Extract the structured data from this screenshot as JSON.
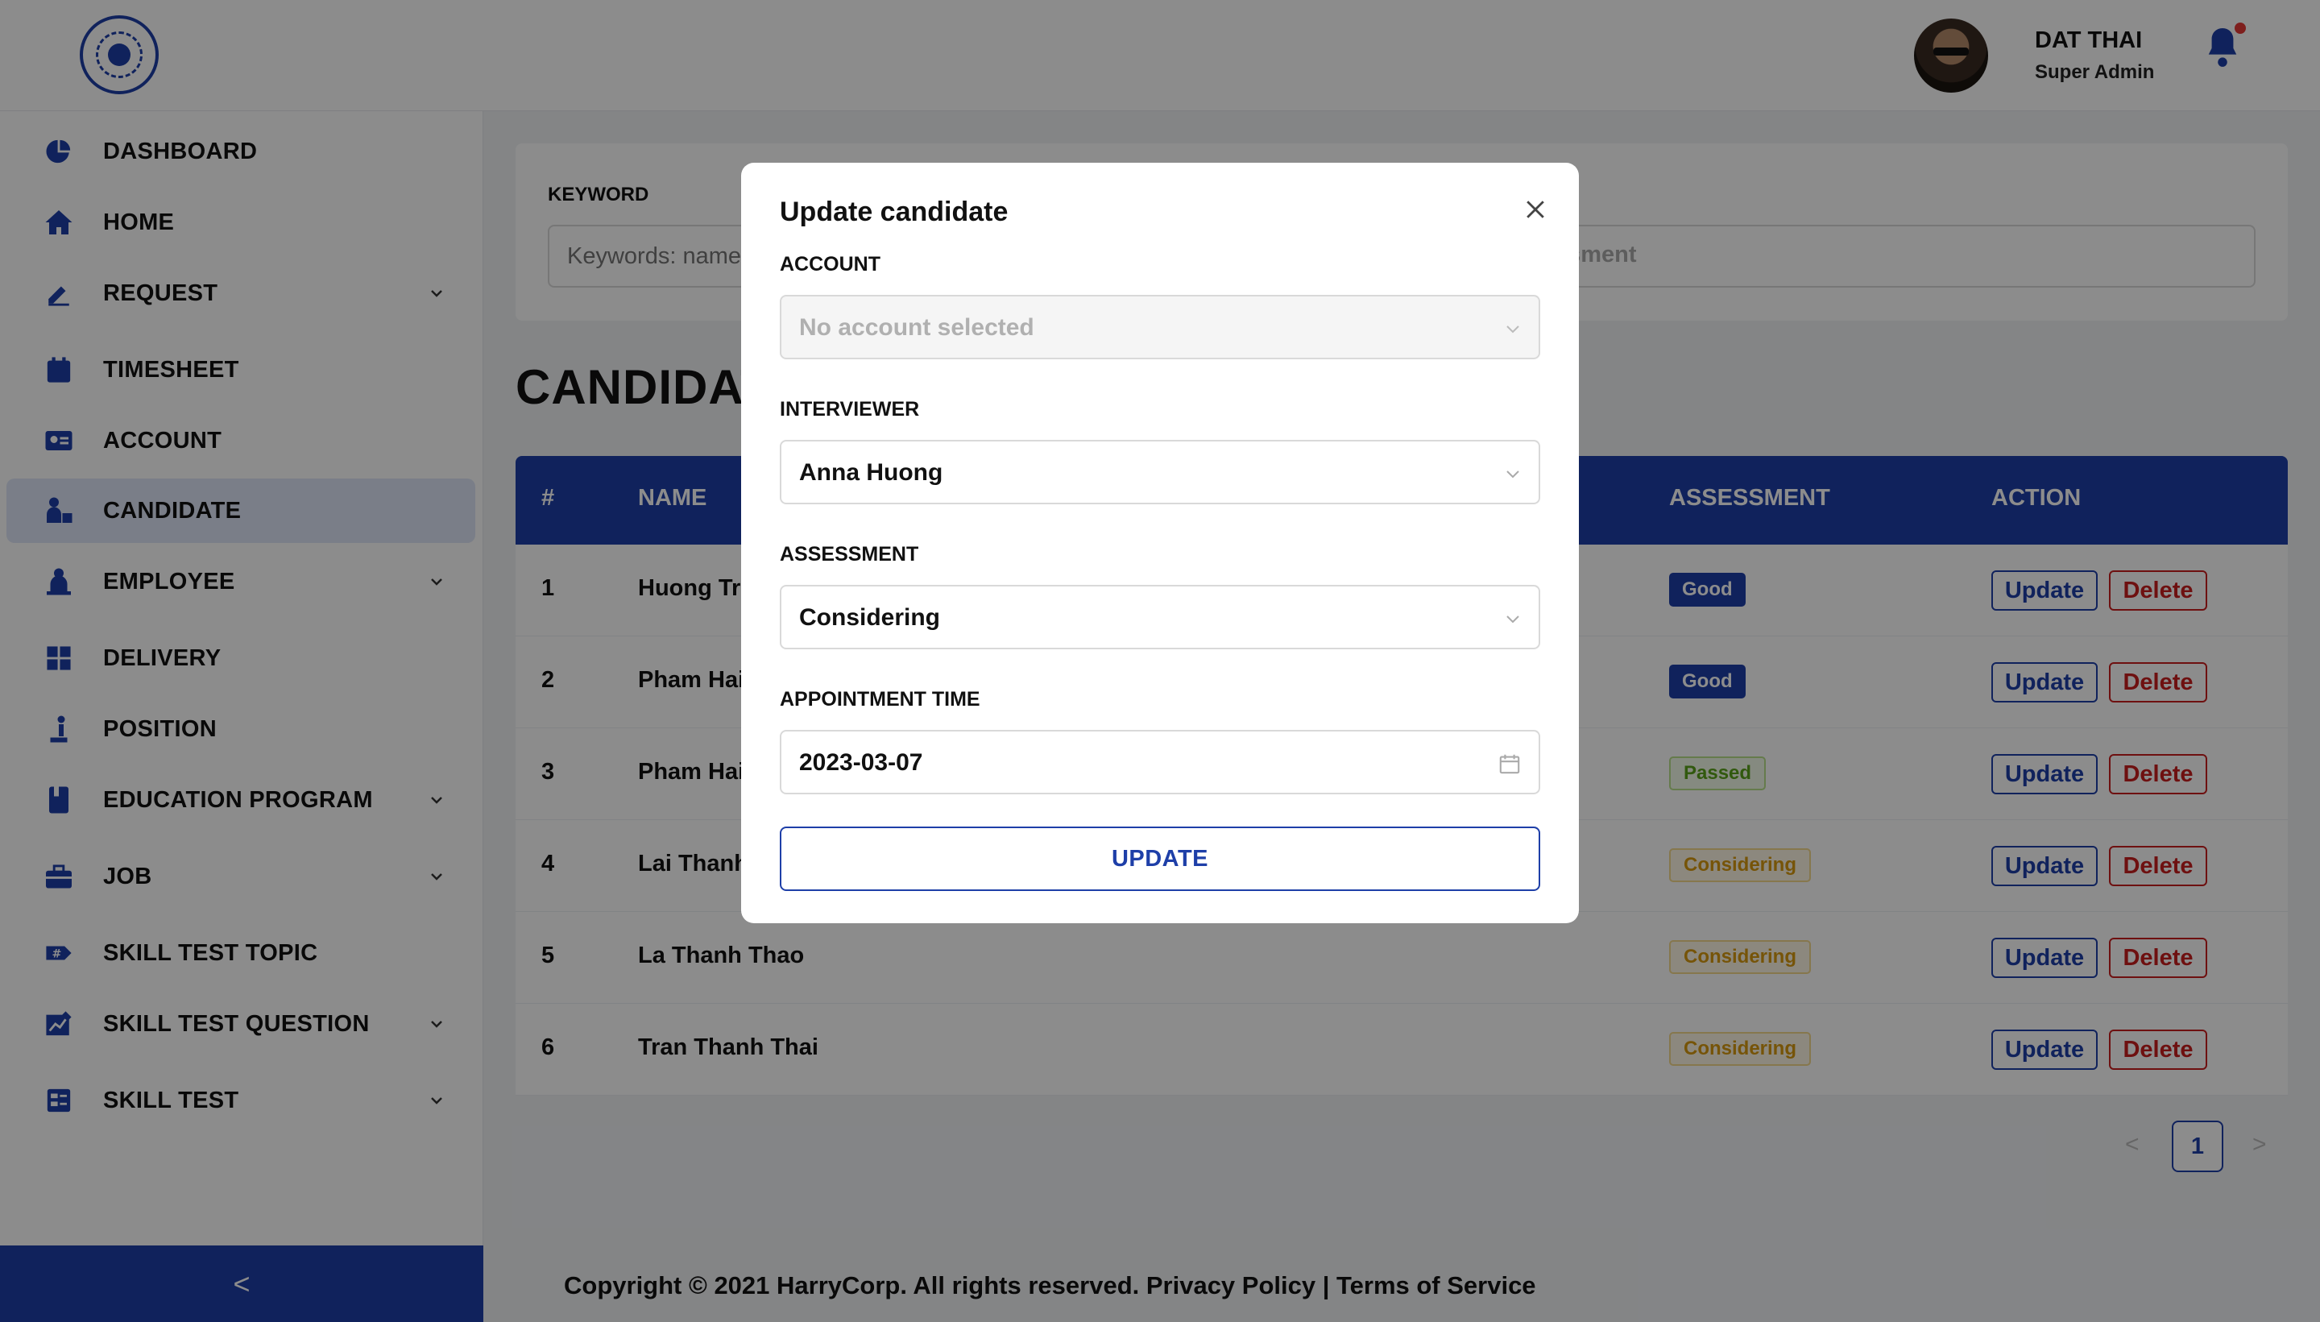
{
  "header": {
    "user_name": "DAT THAI",
    "user_role": "Super Admin"
  },
  "sidebar": {
    "items": [
      {
        "label": "DASHBOARD",
        "icon": "pie-chart-icon",
        "has_submenu": false
      },
      {
        "label": "HOME",
        "icon": "home-icon",
        "has_submenu": false
      },
      {
        "label": "REQUEST",
        "icon": "pencil-icon",
        "has_submenu": true
      },
      {
        "label": "TIMESHEET",
        "icon": "calendar-icon",
        "has_submenu": false
      },
      {
        "label": "ACCOUNT",
        "icon": "id-card-icon",
        "has_submenu": false
      },
      {
        "label": "CANDIDATE",
        "icon": "candidate-icon",
        "has_submenu": false,
        "active": true
      },
      {
        "label": "EMPLOYEE",
        "icon": "employee-icon",
        "has_submenu": true
      },
      {
        "label": "DELIVERY",
        "icon": "grid-icon",
        "has_submenu": false
      },
      {
        "label": "POSITION",
        "icon": "position-icon",
        "has_submenu": false
      },
      {
        "label": "EDUCATION PROGRAM",
        "icon": "book-icon",
        "has_submenu": true
      },
      {
        "label": "JOB",
        "icon": "briefcase-icon",
        "has_submenu": true
      },
      {
        "label": "SKILL TEST TOPIC",
        "icon": "hash-tag-icon",
        "has_submenu": false
      },
      {
        "label": "SKILL TEST QUESTION",
        "icon": "chart-edit-icon",
        "has_submenu": true
      },
      {
        "label": "SKILL TEST",
        "icon": "test-sheet-icon",
        "has_submenu": true
      }
    ],
    "collapse_glyph": "<"
  },
  "filters": {
    "keyword_label": "KEYWORD",
    "keyword_placeholder": "Keywords: name",
    "assessment_placeholder": "ssment"
  },
  "page": {
    "title": "CANDIDAT"
  },
  "table": {
    "headers": [
      "#",
      "NAME",
      "ASSESSMENT",
      "ACTION"
    ],
    "rows": [
      {
        "index": "1",
        "name": "Huong Tra",
        "assessment": "Good"
      },
      {
        "index": "2",
        "name": "Pham Hai",
        "assessment": "Good"
      },
      {
        "index": "3",
        "name": "Pham Hai",
        "assessment": "Passed"
      },
      {
        "index": "4",
        "name": "Lai Thanh",
        "assessment": "Considering"
      },
      {
        "index": "5",
        "name": "La Thanh Thao",
        "assessment": "Considering"
      },
      {
        "index": "6",
        "name": "Tran Thanh Thai",
        "assessment": "Considering"
      }
    ],
    "update_label": "Update",
    "delete_label": "Delete"
  },
  "pagination": {
    "prev": "<",
    "current": "1",
    "next": ">"
  },
  "footer": {
    "text": "Copyright © 2021 HarryCorp. All rights reserved. Privacy Policy | Terms of Service"
  },
  "modal": {
    "title": "Update candidate",
    "account_label": "ACCOUNT",
    "account_value": "No account selected",
    "interviewer_label": "INTERVIEWER",
    "interviewer_value": "Anna Huong",
    "assessment_label": "ASSESSMENT",
    "assessment_value": "Considering",
    "appointment_label": "APPOINTMENT TIME",
    "appointment_value": "2023-03-07",
    "submit_label": "UPDATE"
  },
  "colors": {
    "primary": "#1e3fa8",
    "danger": "#c81e1e",
    "passed": "#5aa21b",
    "considering": "#d89a10"
  }
}
